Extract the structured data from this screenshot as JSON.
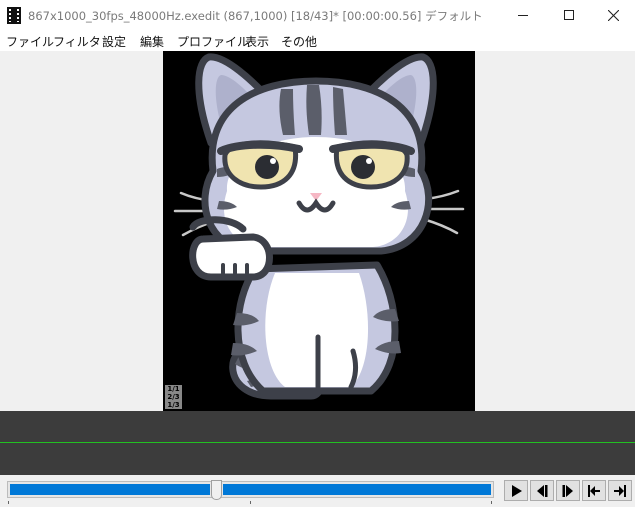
{
  "window": {
    "title": "867x1000_30fps_48000Hz.exedit (867,1000)  [18/43]* [00:00:00.56]  デフォルト"
  },
  "menu": {
    "items": [
      "ファイル",
      "フィルタ",
      "設定",
      "編集",
      "プロファイル",
      "表示",
      "その他"
    ]
  },
  "preview": {
    "layer_badges": [
      "1/1",
      "2/3",
      "1/3"
    ]
  },
  "playback": {
    "frame_current": 18,
    "frame_total": 43,
    "buttons": [
      "play-icon",
      "previous-frame-icon",
      "next-frame-icon",
      "jump-to-start-icon",
      "jump-to-end-icon"
    ]
  },
  "colors": {
    "timeline_bg": "#3c3c3c",
    "timeline_cursor": "#22c022",
    "seek_fill": "#0078d7",
    "cat_body": "#c5c8e0",
    "cat_outline": "#3d4049",
    "cat_eye": "#f0e4b0"
  }
}
